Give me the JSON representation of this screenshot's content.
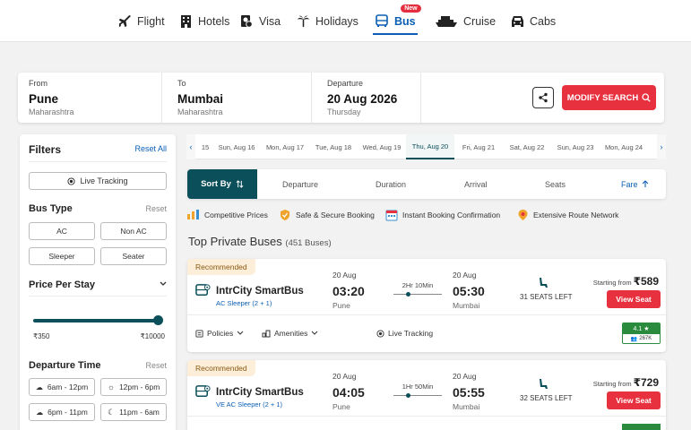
{
  "nav": [
    {
      "label": "Flight",
      "icon": "plane-icon"
    },
    {
      "label": "Hotels",
      "icon": "hotel-icon"
    },
    {
      "label": "Visa",
      "icon": "visa-icon"
    },
    {
      "label": "Holidays",
      "icon": "palm-tree-icon"
    },
    {
      "label": "Bus",
      "icon": "bus-icon",
      "badge": "New"
    },
    {
      "label": "Cruise",
      "icon": "ship-icon"
    },
    {
      "label": "Cabs",
      "icon": "car-icon"
    }
  ],
  "search": {
    "from_label": "From",
    "from_city": "Pune",
    "from_state": "Maharashtra",
    "to_label": "To",
    "to_city": "Mumbai",
    "to_state": "Maharashtra",
    "dep_label": "Departure",
    "dep_date": "20 Aug 2026",
    "dep_day": "Thursday",
    "modify_label": "MODIFY SEARCH"
  },
  "filters": {
    "title": "Filters",
    "reset_all": "Reset All",
    "live_tracking": "Live Tracking",
    "bus_type_title": "Bus Type",
    "reset": "Reset",
    "bus_types": [
      "AC",
      "Non AC",
      "Sleeper",
      "Seater"
    ],
    "price_title": "Price Per Stay",
    "price_min": "₹350",
    "price_max": "₹10000",
    "departure_title": "Departure Time",
    "departure_slots": [
      "6am - 12pm",
      "12pm - 6pm",
      "6pm - 11pm",
      "11pm - 6am"
    ]
  },
  "dates": [
    "15",
    "Sun, Aug 16",
    "Mon, Aug 17",
    "Tue, Aug 18",
    "Wed, Aug 19",
    "Thu, Aug 20",
    "Fri, Aug 21",
    "Sat, Aug 22",
    "Sun, Aug 23",
    "Mon, Aug 24"
  ],
  "sort": {
    "label": "Sort By",
    "options": [
      "Departure",
      "Duration",
      "Arrival",
      "Seats",
      "Fare"
    ]
  },
  "features": [
    "Competitive Prices",
    "Safe & Secure Booking",
    "Instant Booking Confirmation",
    "Extensive Route Network"
  ],
  "section": {
    "title": "Top Private Buses",
    "count": "(451 Buses)"
  },
  "buses": [
    {
      "tag": "Recommended",
      "operator": "IntrCity SmartBus",
      "type": "AC Sleeper (2 + 1)",
      "dep_date": "20 Aug",
      "dep_time": "03:20",
      "dep_city": "Pune",
      "duration": "2Hr 10Min",
      "arr_date": "20 Aug",
      "arr_time": "05:30",
      "arr_city": "Mumbai",
      "seats": "31 SEATS LEFT",
      "starting_from": "Starting from",
      "price": "₹589",
      "view_seat": "View Seat",
      "policies": "Policies",
      "amenities": "Amenities",
      "live_tracking": "Live Tracking",
      "rating": "4.1",
      "reviews": "267K"
    },
    {
      "tag": "Recommended",
      "operator": "IntrCity SmartBus",
      "type": "VE AC Sleeper (2 + 1)",
      "dep_date": "20 Aug",
      "dep_time": "04:05",
      "dep_city": "Pune",
      "duration": "1Hr 50Min",
      "arr_date": "20 Aug",
      "arr_time": "05:55",
      "arr_city": "Mumbai",
      "seats": "32 SEATS LEFT",
      "starting_from": "Starting from",
      "price": "₹729",
      "view_seat": "View Seat"
    }
  ],
  "colors": {
    "primary": "#0b4f5a",
    "accent": "#e8313e",
    "link": "#0a5fb4",
    "rating": "#2a8a3e"
  }
}
